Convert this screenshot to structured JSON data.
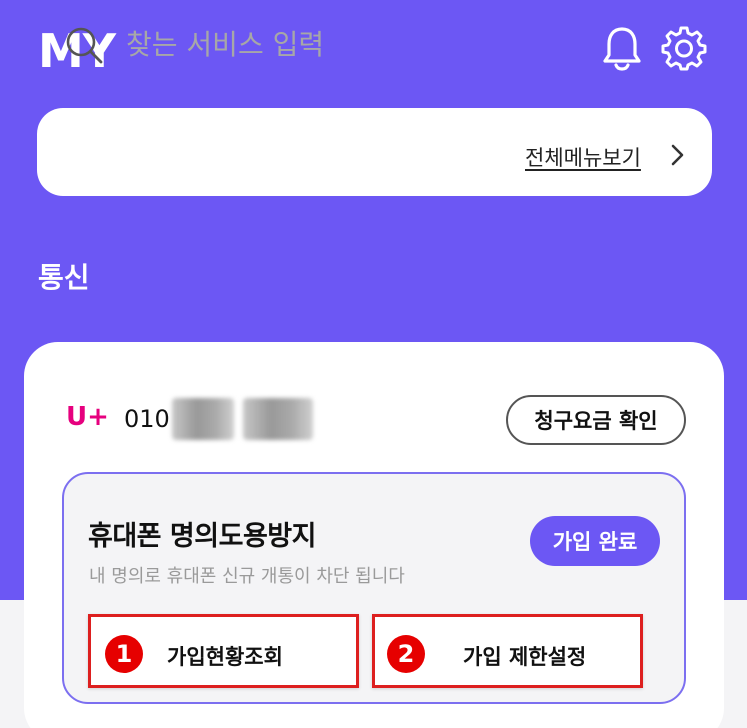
{
  "header": {
    "title": "MY",
    "icons": [
      "bell-icon",
      "gear-icon"
    ]
  },
  "search": {
    "placeholder": "찾는 서비스 입력",
    "value": "",
    "all_menu_label": "전체메뉴보기"
  },
  "section": {
    "title": "통신"
  },
  "line": {
    "carrier": "U+",
    "phone_prefix": "010",
    "bill_button": "청구요금 확인"
  },
  "service": {
    "title": "휴대폰 명의도용방지",
    "description": "내 명의로 휴대폰 신규 개통이 차단 됩니다",
    "status_badge": "가입 완료",
    "actions": [
      {
        "marker": "1",
        "label": "가입현황조회"
      },
      {
        "marker": "2",
        "label": "가입 제한설정"
      }
    ]
  },
  "colors": {
    "brand_purple": "#6c57f4",
    "carrier_pink": "#e6007e",
    "highlight_red": "#dd1f1f"
  }
}
